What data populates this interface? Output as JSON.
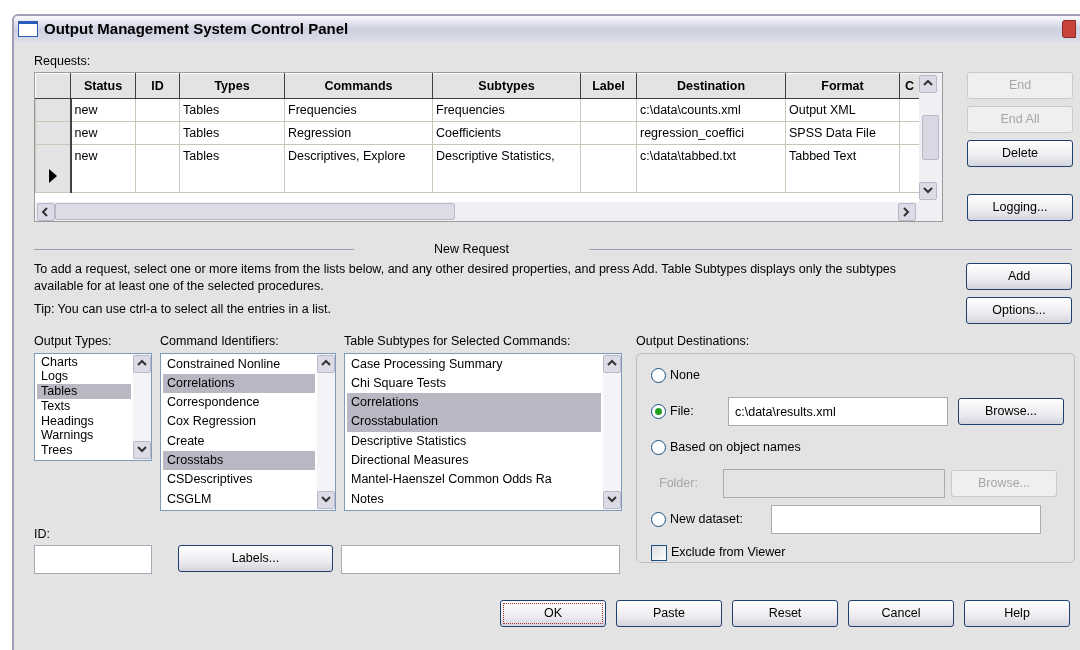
{
  "window": {
    "title": "Output Management System Control Panel"
  },
  "requests": {
    "label": "Requests:",
    "columns": [
      "Status",
      "ID",
      "Types",
      "Commands",
      "Subtypes",
      "Label",
      "Destination",
      "Format",
      "C"
    ],
    "rows": [
      {
        "current": false,
        "status": "new",
        "types": "Tables",
        "commands": "Frequencies",
        "subtypes": "Frequencies",
        "destination": "c:\\data\\counts.xml",
        "format": "Output XML"
      },
      {
        "current": false,
        "status": "new",
        "types": "Tables",
        "commands": "Regression",
        "subtypes": "Coefficients",
        "destination": "regression_coeffici",
        "format": "SPSS Data File"
      },
      {
        "current": true,
        "status": "new",
        "types": "Tables",
        "commands": "Descriptives, Explore",
        "subtypes": "Descriptive Statistics,",
        "destination": "c:\\data\\tabbed.txt",
        "format": "Tabbed Text"
      }
    ]
  },
  "side_buttons": [
    {
      "label": "End",
      "disabled": true
    },
    {
      "label": "End All",
      "disabled": true
    },
    {
      "label": "Delete",
      "disabled": false
    },
    {
      "label": "Logging...",
      "disabled": false
    }
  ],
  "new_request": {
    "title": "New Request",
    "instructions": "To add a request, select one or more items from the lists below, and any other desired properties, and press Add. Table Subtypes displays only the subtypes available for at least one of the selected procedures.",
    "tip": "Tip: You can use ctrl-a to select all the entries in a list.",
    "buttons": [
      {
        "label": "Add"
      },
      {
        "label": "Options..."
      }
    ]
  },
  "lists": [
    {
      "label": "Output Types:",
      "items": [
        {
          "text": "Charts",
          "selected": false
        },
        {
          "text": "Logs",
          "selected": false
        },
        {
          "text": "Tables",
          "selected": true
        },
        {
          "text": "Texts",
          "selected": false
        },
        {
          "text": "Headings",
          "selected": false
        },
        {
          "text": "Warnings",
          "selected": false
        },
        {
          "text": "Trees",
          "selected": false
        }
      ]
    },
    {
      "label": "Command Identifiers:",
      "items": [
        {
          "text": "Constrained Nonline",
          "selected": false
        },
        {
          "text": "Correlations",
          "selected": true
        },
        {
          "text": "Correspondence",
          "selected": false
        },
        {
          "text": "Cox Regression",
          "selected": false
        },
        {
          "text": "Create",
          "selected": false
        },
        {
          "text": "Crosstabs",
          "selected": true
        },
        {
          "text": "CSDescriptives",
          "selected": false
        },
        {
          "text": "CSGLM",
          "selected": false
        }
      ]
    },
    {
      "label": "Table Subtypes for Selected Commands:",
      "items": [
        {
          "text": "Case Processing Summary",
          "selected": false
        },
        {
          "text": "Chi Square Tests",
          "selected": false
        },
        {
          "text": "Correlations",
          "selected": true
        },
        {
          "text": "Crosstabulation",
          "selected": true
        },
        {
          "text": "Descriptive Statistics",
          "selected": false
        },
        {
          "text": "Directional Measures",
          "selected": false
        },
        {
          "text": "Mantel-Haenszel Common Odds Ra",
          "selected": false
        },
        {
          "text": "Notes",
          "selected": false
        }
      ]
    }
  ],
  "destinations": {
    "label": "Output Destinations:",
    "options": [
      {
        "kind": "plain",
        "label": "None",
        "selected": false
      },
      {
        "kind": "file",
        "label": "File:",
        "selected": true,
        "value": "c:\\data\\results.xml",
        "button": "Browse..."
      },
      {
        "kind": "folder",
        "label": "Based on object names",
        "selected": false,
        "field_label": "Folder:",
        "button": "Browse...",
        "disabled": true
      },
      {
        "kind": "dataset",
        "label": "New dataset:",
        "selected": false
      }
    ],
    "exclude": {
      "label": "Exclude from Viewer",
      "checked": false
    }
  },
  "id_field": {
    "label": "ID:"
  },
  "labels_button": "Labels...",
  "footer_buttons": [
    {
      "label": "OK",
      "default": true
    },
    {
      "label": "Paste",
      "default": false
    },
    {
      "label": "Reset",
      "default": false
    },
    {
      "label": "Cancel",
      "default": false
    },
    {
      "label": "Help",
      "default": false
    }
  ]
}
